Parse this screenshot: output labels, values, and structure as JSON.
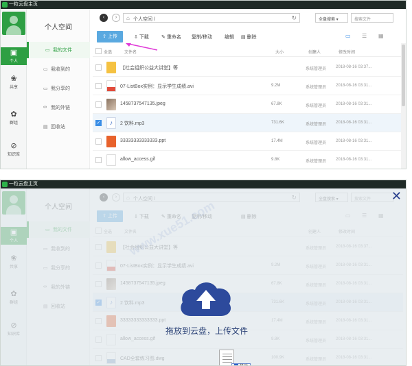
{
  "app": {
    "title": "一粒云盘主页"
  },
  "rail": {
    "items": [
      {
        "icon": "person-icon",
        "label": "个人",
        "active": true
      },
      {
        "icon": "share-icon",
        "label": "共享"
      },
      {
        "icon": "group-icon",
        "label": "群组"
      },
      {
        "icon": "compass-icon",
        "label": "知识库"
      }
    ]
  },
  "sidebar": {
    "title": "个人空间",
    "items": [
      {
        "icon": "folder-icon",
        "label": "我的文件",
        "active": true
      },
      {
        "icon": "inbox-icon",
        "label": "我收到的"
      },
      {
        "icon": "share-out-icon",
        "label": "我分享的"
      },
      {
        "icon": "link-icon",
        "label": "我的外链"
      },
      {
        "icon": "trash-icon",
        "label": "回收站"
      }
    ]
  },
  "toolbar": {
    "path": "个人空间 /",
    "search_scope": "全盘搜索 ▾",
    "search_placeholder": "搜索文件"
  },
  "actions": {
    "upload": "上传",
    "download": "下载",
    "rename": "重命名",
    "copymove": "复制/移动",
    "edit": "编辑",
    "delete": "删除"
  },
  "table": {
    "headers": {
      "all": "全选",
      "name": "文件名",
      "size": "大小",
      "owner": "创建人",
      "time": "修改时间"
    },
    "rows": [
      {
        "name": "【社会组织公益大讲堂】等",
        "size": "",
        "owner": "系统管理员",
        "time": "2018-08-16 03:37...",
        "type": "folder",
        "checked": false
      },
      {
        "name": "07-ListBox实例：显示学生成绩.avi",
        "size": "9.2M",
        "owner": "系统管理员",
        "time": "2018-08-16 03:31...",
        "type": "video",
        "checked": false
      },
      {
        "name": "1458737547135.jpeg",
        "size": "67.8K",
        "owner": "系统管理员",
        "time": "2018-08-16 03:31...",
        "type": "image",
        "checked": false
      },
      {
        "name": "2 饮料.mp3",
        "size": "731.6K",
        "owner": "系统管理员",
        "time": "2018-08-16 03:31...",
        "type": "audio",
        "checked": true
      },
      {
        "name": "33333333333333.ppt",
        "size": "17.4M",
        "owner": "系统管理员",
        "time": "2018-08-16 03:31...",
        "type": "ppt",
        "checked": false
      },
      {
        "name": "allow_access.gif",
        "size": "9.8K",
        "owner": "系统管理员",
        "time": "2018-08-16 03:31...",
        "type": "gif",
        "checked": false
      },
      {
        "name": "CAD全套练习图.dwg",
        "size": "100.9K",
        "owner": "系统管理员",
        "time": "2018-08-16 03:31...",
        "type": "dwg",
        "checked": false
      }
    ]
  },
  "overlay": {
    "drop_text": "拖放到云盘，上传文件",
    "move_label": "移动"
  },
  "colors": {
    "accent": "#2e9f43",
    "upload": "#5aa9e0",
    "cloud": "#2d4a9c"
  }
}
